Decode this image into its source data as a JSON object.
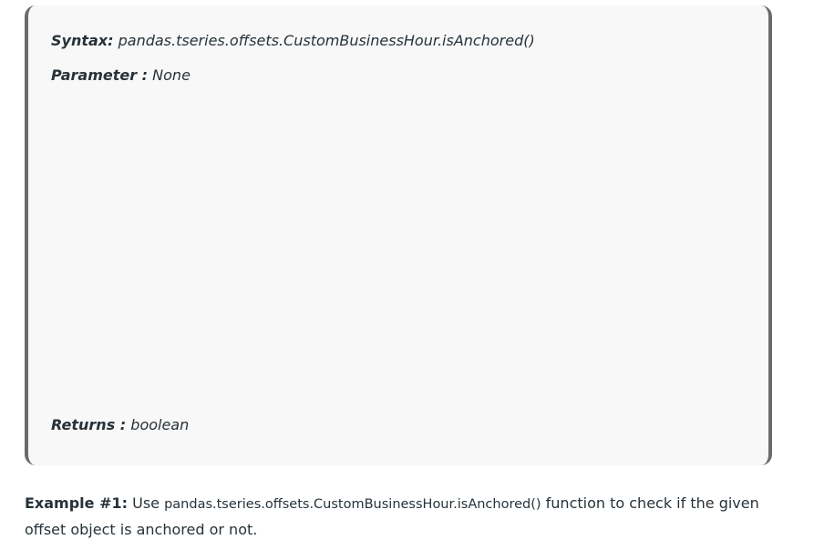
{
  "syntax_box": {
    "syntax_label": "Syntax:",
    "syntax_value": "pandas.tseries.offsets.CustomBusinessHour.isAnchored()",
    "parameter_label": "Parameter :",
    "parameter_value": "None",
    "returns_label": "Returns :",
    "returns_value": "boolean"
  },
  "example": {
    "label": "Example #1:",
    "text_before": "Use",
    "code": "pandas.tseries.offsets.CustomBusinessHour.isAnchored()",
    "text_after": "function to check if the given offset object is anchored or not."
  }
}
